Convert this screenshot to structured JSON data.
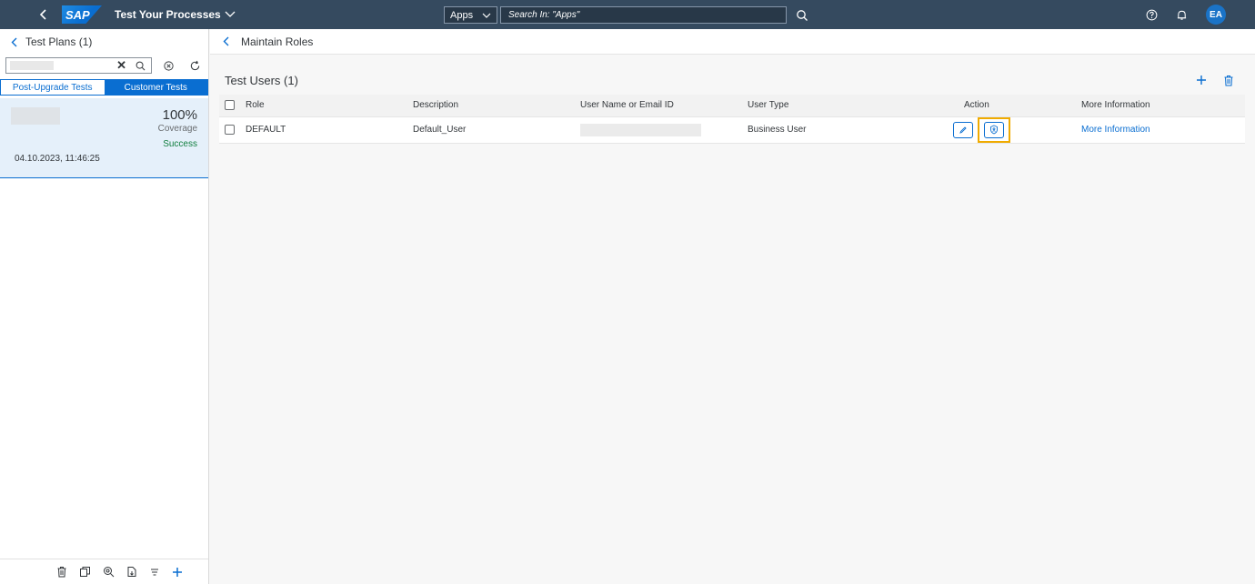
{
  "shell": {
    "logo_text": "SAP",
    "app_title": "Test Your Processes",
    "search_scope": "Apps",
    "search_placeholder": "Search In: \"Apps\"",
    "avatar_initials": "EA"
  },
  "left": {
    "header": "Test Plans (1)",
    "tabs": [
      "Post-Upgrade Tests",
      "Customer Tests"
    ],
    "active_tab": "Customer Tests",
    "plan": {
      "coverage_value": "100%",
      "coverage_label": "Coverage",
      "status": "Success",
      "date": "04.10.2023, 11:46:25"
    }
  },
  "main": {
    "breadcrumb": "Maintain Roles",
    "table_title": "Test Users (1)",
    "columns": [
      "Role",
      "Description",
      "User Name or Email ID",
      "User Type",
      "Action",
      "More Information"
    ],
    "rows": [
      {
        "role": "DEFAULT",
        "description": "Default_User",
        "user_type": "Business User",
        "more_info": "More Information"
      }
    ]
  },
  "colors": {
    "shell_bg": "#354a5f",
    "accent": "#0a6ed1",
    "highlight": "#f0ab00",
    "success": "#107e3e"
  }
}
